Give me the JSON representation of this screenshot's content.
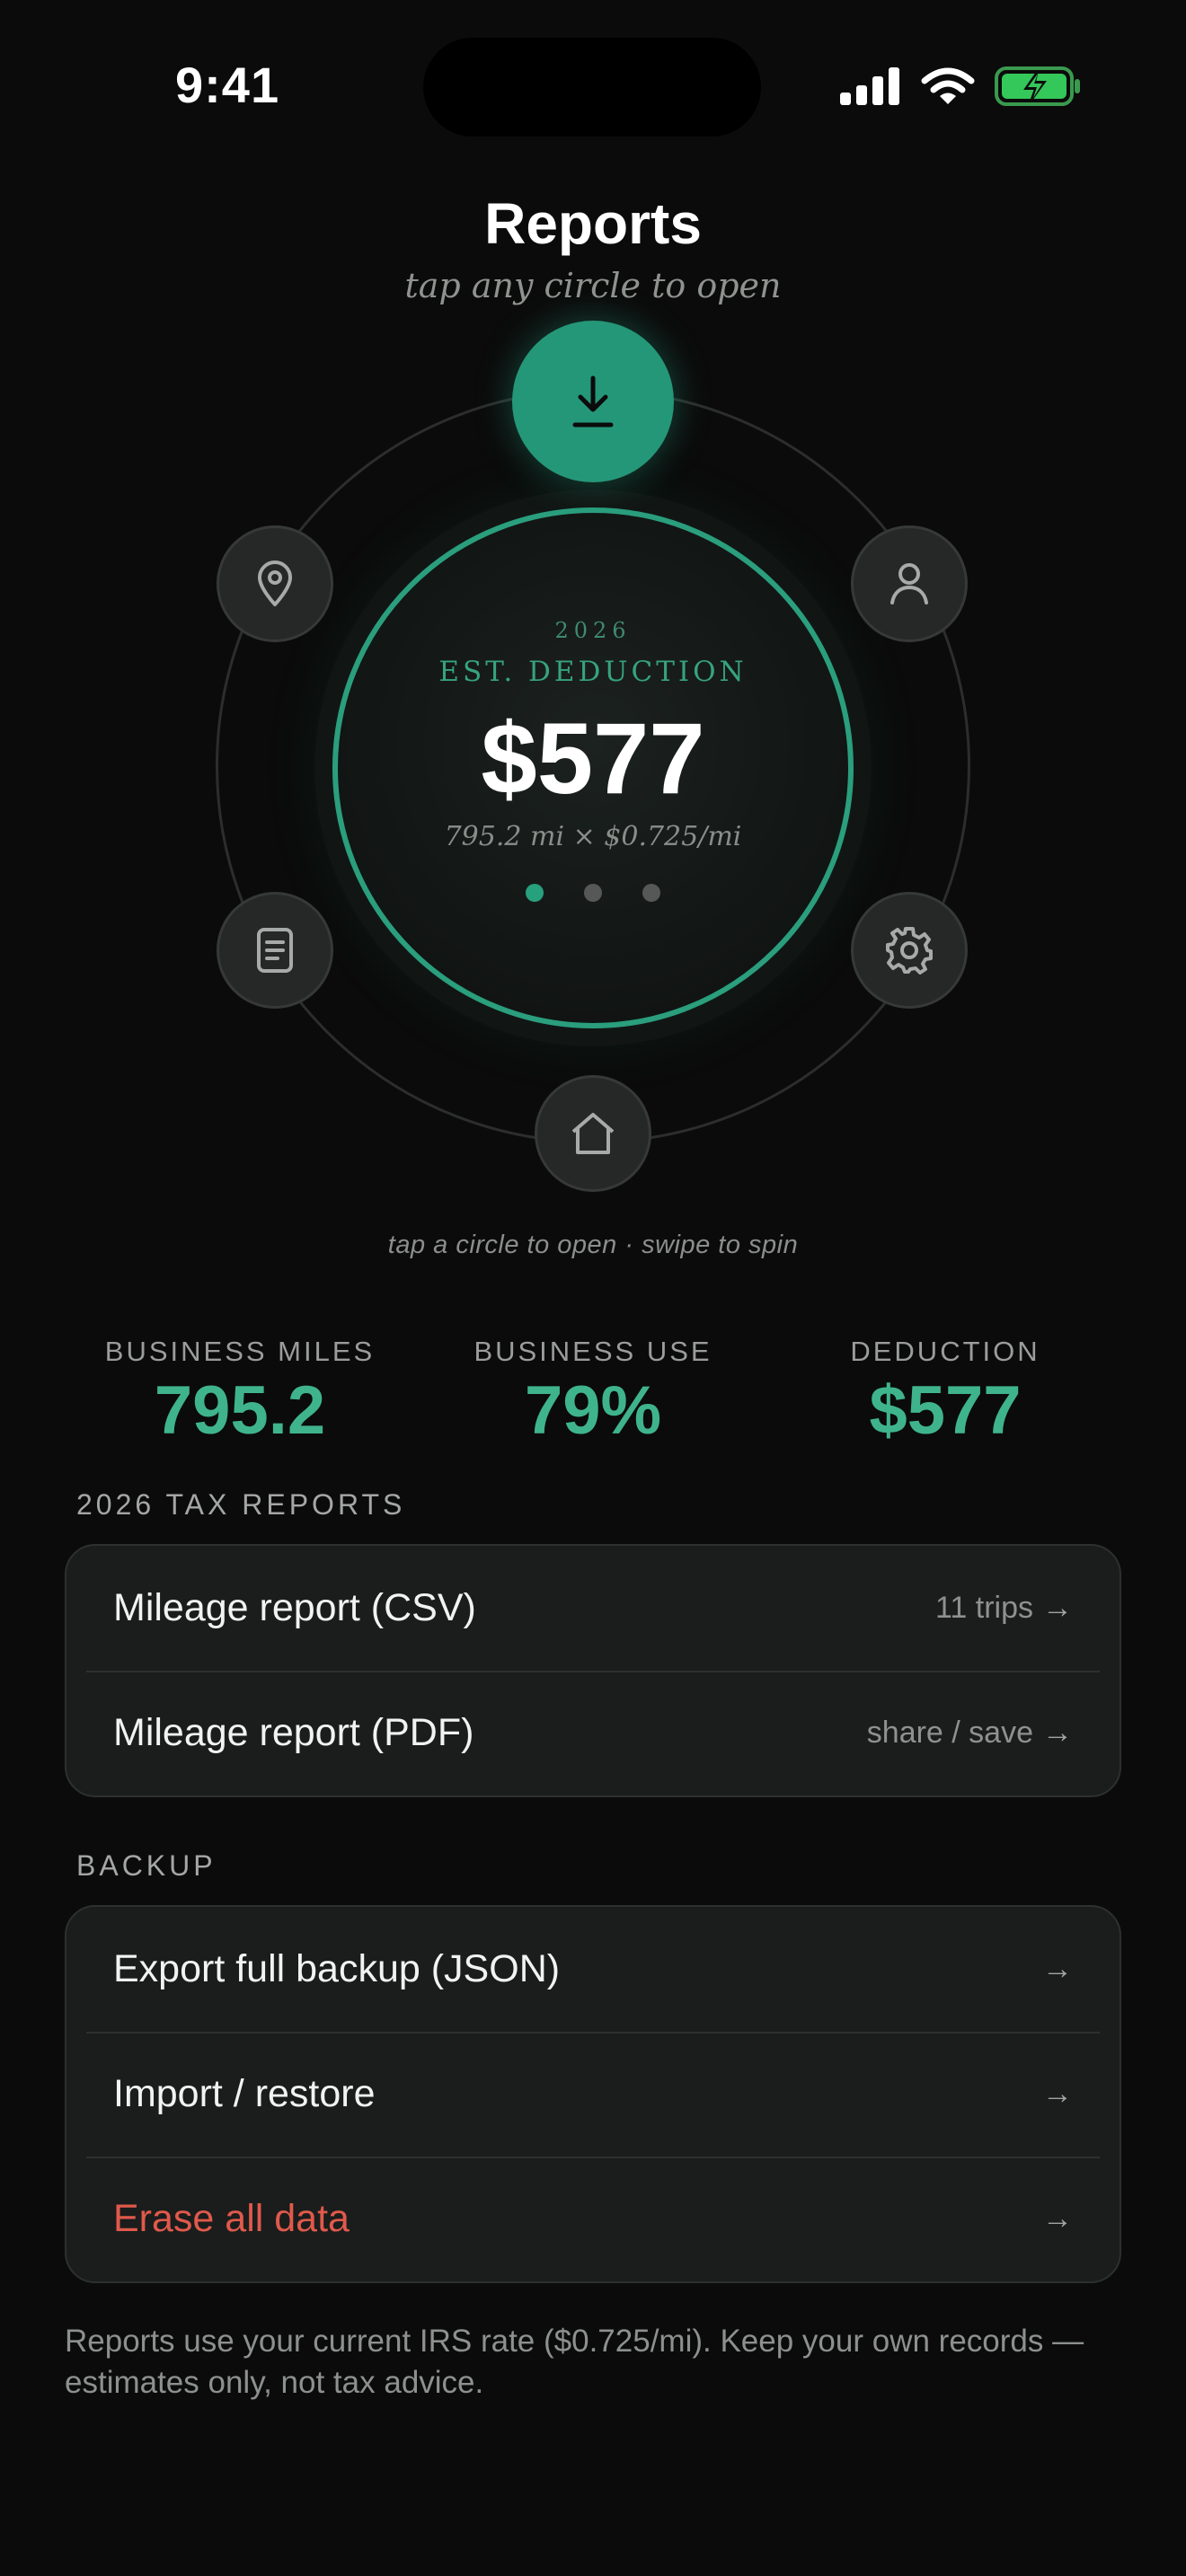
{
  "status_bar": {
    "time": "9:41"
  },
  "header": {
    "title": "Reports",
    "subtitle": "tap any circle to open"
  },
  "dial": {
    "year": "2026",
    "label": "EST. DEDUCTION",
    "value": "$577",
    "formula": "795.2 mi × $0.725/mi",
    "page_count": 3,
    "active_page": 0,
    "hint": "tap a circle to open · swipe to spin",
    "nodes": [
      "download-icon",
      "map-pin-icon",
      "user-icon",
      "document-icon",
      "gear-icon",
      "home-icon"
    ]
  },
  "stats": [
    {
      "label": "BUSINESS MILES",
      "value": "795.2"
    },
    {
      "label": "BUSINESS USE",
      "value": "79%"
    },
    {
      "label": "DEDUCTION",
      "value": "$577"
    }
  ],
  "tax_reports": {
    "heading": "2026 TAX REPORTS",
    "rows": [
      {
        "label": "Mileage report (CSV)",
        "meta": "11 trips"
      },
      {
        "label": "Mileage report (PDF)",
        "meta": "share / save"
      }
    ]
  },
  "backup": {
    "heading": "BACKUP",
    "rows": [
      {
        "label": "Export full backup (JSON)"
      },
      {
        "label": "Import / restore"
      },
      {
        "label": "Erase all data"
      }
    ]
  },
  "arrow_glyph": "→",
  "footnote": "Reports use your current IRS rate ($0.725/mi). Keep your own records — estimates only, not tax advice.",
  "colors": {
    "accent": "#27a07d",
    "danger": "#e0594b",
    "background": "#0b0b0b",
    "battery": "#34c759"
  }
}
